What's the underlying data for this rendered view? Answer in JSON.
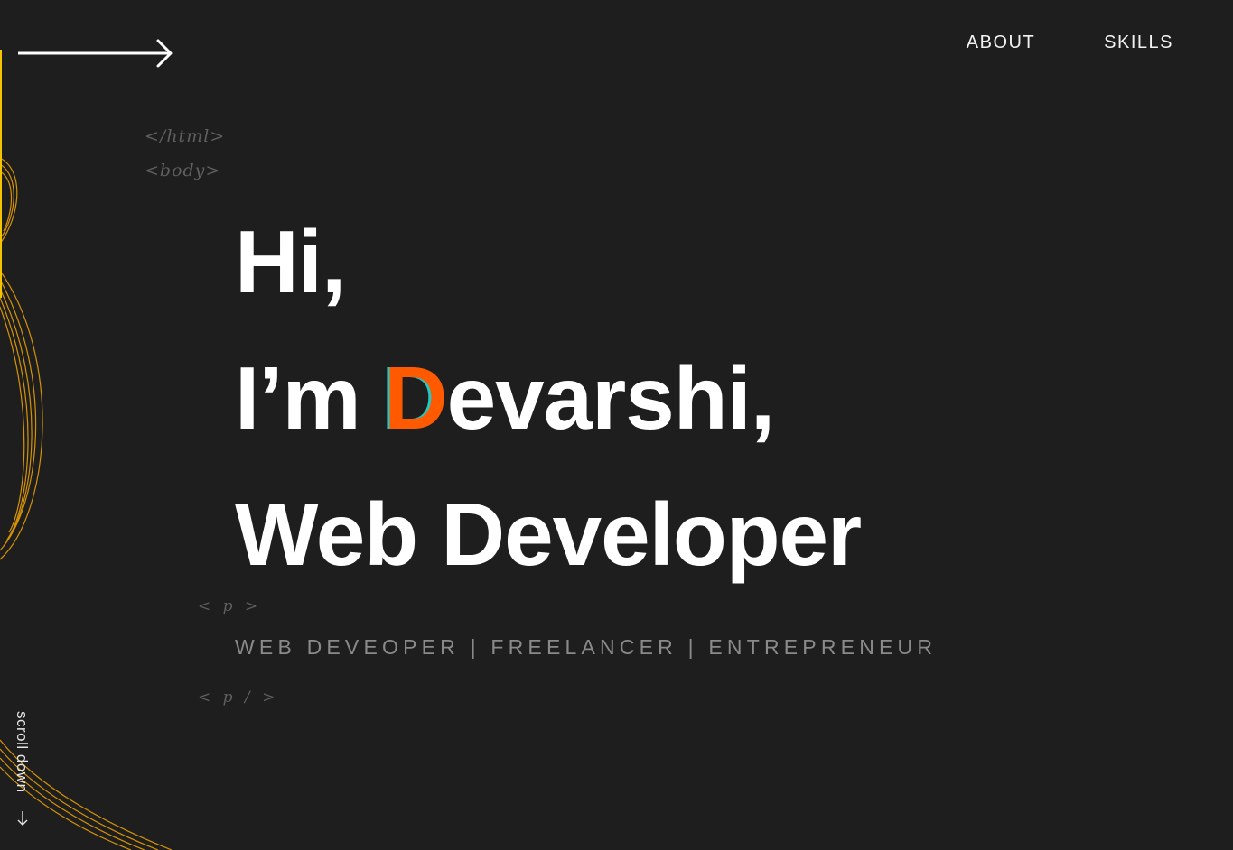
{
  "nav": {
    "items": [
      "ABOUT",
      "SKILLS"
    ]
  },
  "code_tags": {
    "html_close": "</html>",
    "body_open": "<body>",
    "p_open": "< p >",
    "p_close": "< p / >"
  },
  "hero": {
    "line1": "Hi,",
    "line2_prefix": "I’m ",
    "line2_accent": "D",
    "line2_rest": "evarshi,",
    "line3": "Web Developer"
  },
  "subtitle": "WEB DEVEOPER | FREELANCER | ENTREPRENEUR",
  "scroll": {
    "label": "scroll down",
    "icon": "arrow-down-icon"
  },
  "menu_icon": "arrow-right-icon",
  "colors": {
    "background": "#1e1e1e",
    "accent": "#ff5a00",
    "accent_outline": "#1fc9c9",
    "swirl": "#f5a800"
  }
}
